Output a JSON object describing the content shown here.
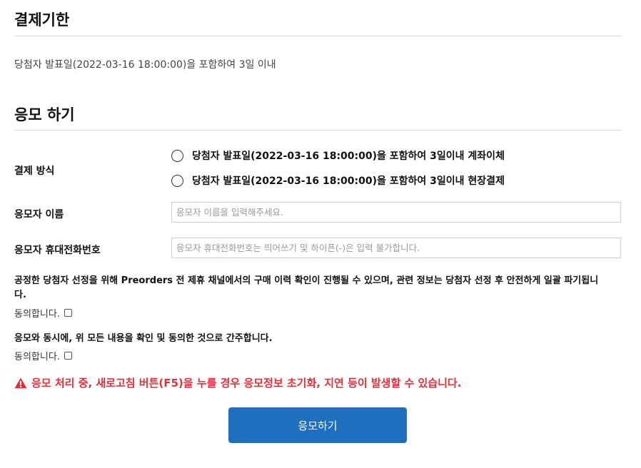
{
  "payment_deadline": {
    "title": "결제기한",
    "text": "당첨자 발표일(2022-03-16 18:00:00)을 포함하여 3일 이내"
  },
  "apply": {
    "title": "응모 하기",
    "payment_method_label": "결제 방식",
    "payment_options": [
      "당첨자 발표일(2022-03-16 18:00:00)을 포함하여 3일이내 계좌이체",
      "당첨자 발표일(2022-03-16 18:00:00)을 포함하여 3일이내 현장결제"
    ],
    "name_label": "응모자 이름",
    "name_placeholder": "응모자 이름을 입력해주세요.",
    "phone_label": "응모자 휴대전화번호",
    "phone_placeholder": "응모자 휴대전화번호는 띄어쓰기 및 하이픈(-)은 입력 불가합니다.",
    "consent_notice_1": "공정한 당첨자 선정을 위해 Preorders 전 제휴 채널에서의 구매 이력 확인이 진행될 수 있으며, 관련 정보는 당첨자 선정 후 안전하게 일괄 파기됩니다.",
    "consent_notice_2": "응모와 동시에, 위 모든 내용을 확인 및 동의한 것으로 간주합니다.",
    "agree_label": "동의합니다.",
    "warning": "응모 처리 중, 새로고침 버튼(F5)을 누를 경우 응모정보 초기화, 지연 등이 발생할 수 있습니다.",
    "submit_label": "응모하기"
  },
  "colors": {
    "warning": "#e0303a",
    "button": "#1f6fbf"
  },
  "icons": {
    "warning": "warning-triangle-icon"
  }
}
